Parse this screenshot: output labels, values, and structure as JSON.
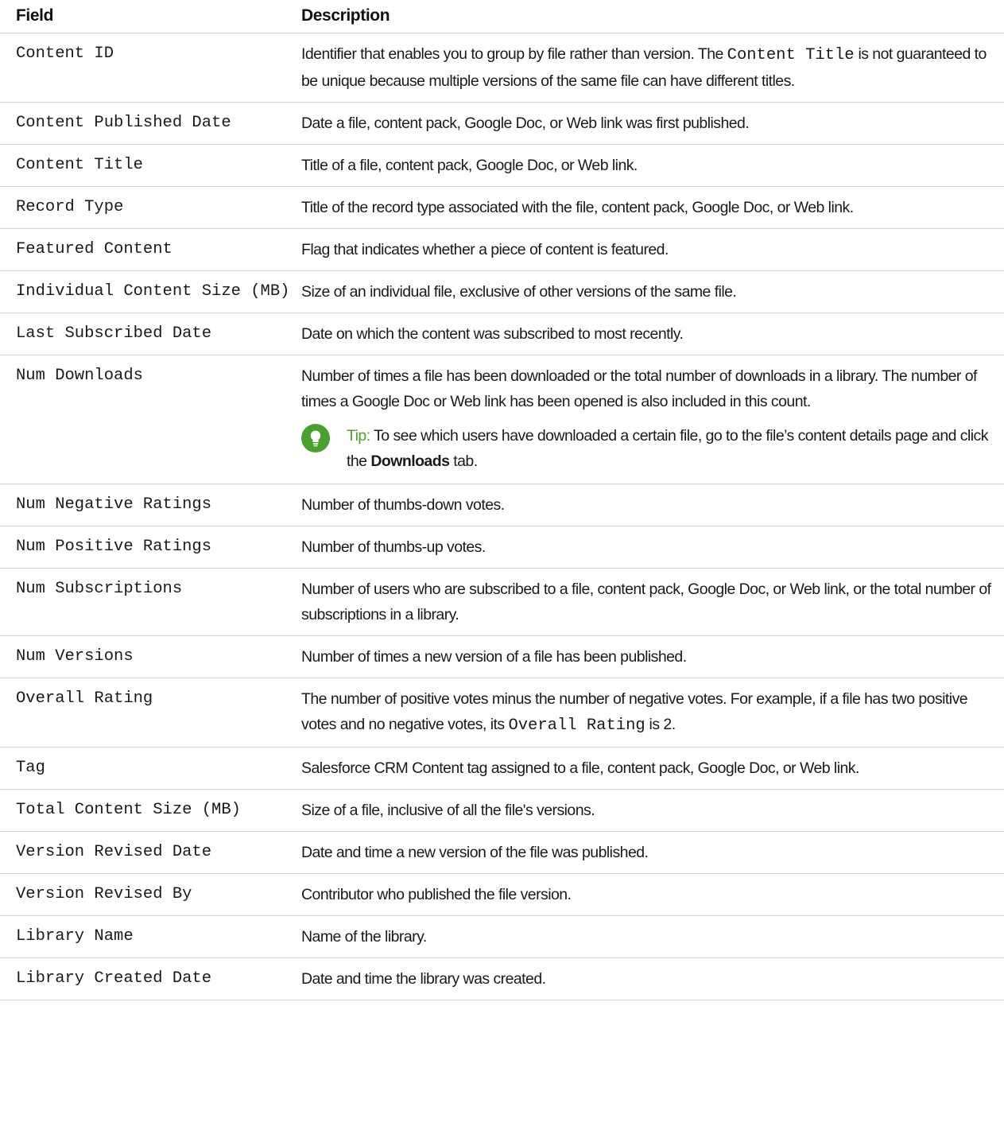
{
  "table": {
    "header": {
      "field": "Field",
      "description": "Description"
    },
    "rows": [
      {
        "field": "Content ID",
        "description_before": "Identifier that enables you to group by file rather than version. The ",
        "description_code": "Content Title",
        "description_after": " is not guaranteed to be unique because multiple versions of the same file can have different titles."
      },
      {
        "field": "Content Published Date",
        "description": "Date a file, content pack, Google Doc, or Web link was first published."
      },
      {
        "field": "Content Title",
        "description": "Title of a file, content pack, Google Doc, or Web link."
      },
      {
        "field": "Record Type",
        "description": "Title of the record type associated with the file, content pack, Google Doc, or Web link."
      },
      {
        "field": "Featured Content",
        "description": "Flag that indicates whether a piece of content is featured."
      },
      {
        "field": "Individual Content Size (MB)",
        "description": "Size of an individual file, exclusive of other versions of the same file."
      },
      {
        "field": "Last Subscribed Date",
        "description": "Date on which the content was subscribed to most recently."
      },
      {
        "field": "Num Downloads",
        "description": "Number of times a file has been downloaded or the total number of downloads in a library. The number of times a Google Doc or Web link has been opened is also included in this count.",
        "tip": {
          "label": "Tip:",
          "text_before": "To see which users have downloaded a certain file, go to the file’s content details page and click the ",
          "text_bold": "Downloads",
          "text_after": " tab.",
          "icon": "lightbulb-icon",
          "icon_color": "#4aa02c"
        }
      },
      {
        "field": "Num Negative Ratings",
        "description": "Number of thumbs-down votes."
      },
      {
        "field": "Num Positive Ratings",
        "description": "Number of thumbs-up votes."
      },
      {
        "field": "Num Subscriptions",
        "description": "Number of users who are subscribed to a file, content pack, Google Doc, or Web link, or the total number of subscriptions in a library."
      },
      {
        "field": "Num Versions",
        "description": "Number of times a new version of a file has been published."
      },
      {
        "field": "Overall Rating",
        "description_before": "The number of positive votes minus the number of negative votes. For example, if a file has two positive votes and no negative votes, its ",
        "description_code": "Overall Rating",
        "description_after": " is 2."
      },
      {
        "field": "Tag",
        "description": "Salesforce CRM Content tag assigned to a file, content pack, Google Doc, or Web link."
      },
      {
        "field": "Total Content Size (MB)",
        "description": "Size of a file, inclusive of all the file's versions."
      },
      {
        "field": "Version Revised Date",
        "description": "Date and time a new version of the file was published."
      },
      {
        "field": "Version Revised By",
        "description": "Contributor who published the file version."
      },
      {
        "field": "Library Name",
        "description": "Name of the library."
      },
      {
        "field": "Library Created Date",
        "description": "Date and time the library was created."
      }
    ]
  }
}
